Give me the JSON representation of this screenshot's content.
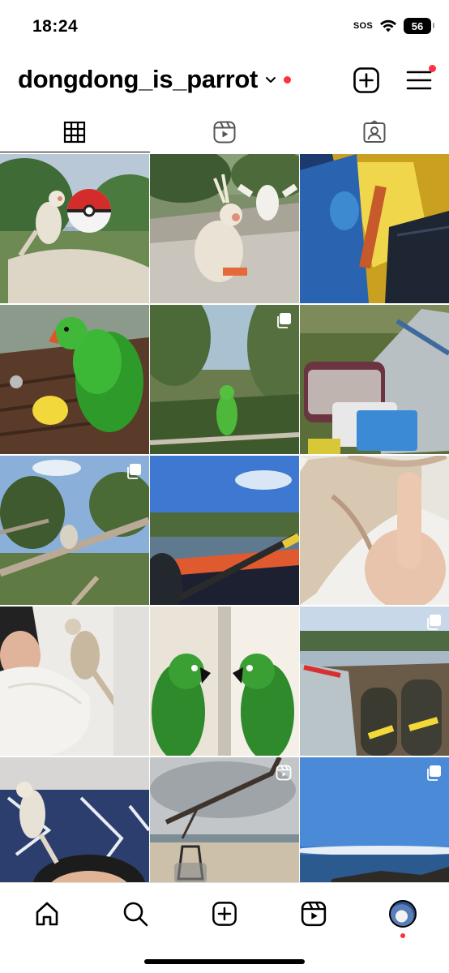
{
  "status_bar": {
    "time": "18:24",
    "sos": "SOS",
    "battery": "56"
  },
  "header": {
    "username": "dongdong_is_parrot",
    "create_icon": "plus-square-icon",
    "menu_icon": "hamburger-menu-icon"
  },
  "tabs": [
    {
      "name": "posts",
      "icon": "grid-icon",
      "active": true
    },
    {
      "name": "reels",
      "icon": "reels-icon",
      "active": false
    },
    {
      "name": "tagged",
      "icon": "tagged-person-icon",
      "active": false
    }
  ],
  "grid": {
    "posts": [
      {
        "subject": "cockatiel with pokeball toy",
        "badge": null
      },
      {
        "subject": "two cockatiels on fence",
        "badge": null
      },
      {
        "subject": "tent interior at night",
        "badge": null
      },
      {
        "subject": "green parrot eating corn",
        "badge": null
      },
      {
        "subject": "green parrot on branch in forest",
        "badge": "carousel"
      },
      {
        "subject": "tent and pet carriers on grass",
        "badge": null
      },
      {
        "subject": "cockatiel on branch under sky",
        "badge": "carousel"
      },
      {
        "subject": "kayak on river",
        "badge": null
      },
      {
        "subject": "bird foot on finger",
        "badge": null
      },
      {
        "subject": "cockatiel on person shoulder",
        "badge": null
      },
      {
        "subject": "green parrot mirror reflection",
        "badge": null
      },
      {
        "subject": "sneakers and bird carrier on rocks",
        "badge": "carousel"
      },
      {
        "subject": "cockatiel with person lying down",
        "badge": null
      },
      {
        "subject": "beach with driftwood and carrier",
        "badge": "reel"
      },
      {
        "subject": "ocean and rocks",
        "badge": "carousel"
      }
    ]
  },
  "bottom_nav": [
    {
      "name": "home",
      "icon": "home-icon"
    },
    {
      "name": "search",
      "icon": "search-icon"
    },
    {
      "name": "create",
      "icon": "plus-square-icon"
    },
    {
      "name": "reels",
      "icon": "reels-icon"
    },
    {
      "name": "profile",
      "icon": "avatar"
    }
  ],
  "colors": {
    "notification_dot": "#ff3040",
    "divider": "#dbdbdb"
  }
}
